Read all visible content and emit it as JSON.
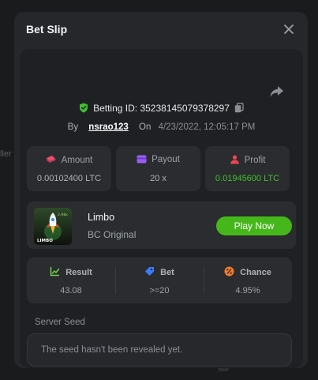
{
  "backdrop": {
    "left_fragment": "ller"
  },
  "modal": {
    "title": "Bet Slip",
    "close_symbol": "✕",
    "bet": {
      "id_label": "Betting ID:",
      "id_value": "35238145079378297",
      "by_label": "By",
      "user": "nsrao123",
      "on_label": "On",
      "timestamp": "4/23/2022, 12:05:17 PM"
    },
    "stats": [
      {
        "label": "Amount",
        "value": "0.00102400 LTC",
        "icon": "money-icon",
        "icon_color": "#e94f6b"
      },
      {
        "label": "Payout",
        "value": "20 x",
        "icon": "wallet-icon",
        "icon_color": "#9b5cf6"
      },
      {
        "label": "Profit",
        "value": "0.01945600 LTC",
        "icon": "profit-person-icon",
        "icon_color": "#e9464f",
        "value_color": "#3fc22a"
      }
    ],
    "game": {
      "name": "Limbo",
      "provider": "BC Original",
      "thumb_text": "LIMBO",
      "thumb_badge": "2.98x",
      "play_label": "Play Now"
    },
    "result": [
      {
        "label": "Result",
        "value": "43.08",
        "icon": "chart-line-icon",
        "icon_color": "#6fd14a"
      },
      {
        "label": "Bet",
        "value": ">=20",
        "icon": "tag-icon",
        "icon_color": "#3b7dff"
      },
      {
        "label": "Chance",
        "value": "4.95%",
        "icon": "percent-icon",
        "icon_color": "#f27a2b"
      }
    ],
    "seed": {
      "label": "Server Seed",
      "text": "The seed hasn't been revealed yet."
    }
  },
  "colors": {
    "background": "#1a1b1d",
    "modal": "#25272a",
    "panel": "#1e2023",
    "card": "#2a2c2f",
    "accent_green": "#46b71b",
    "profit_green": "#3fc22a",
    "shield_green": "#3fc22a"
  }
}
